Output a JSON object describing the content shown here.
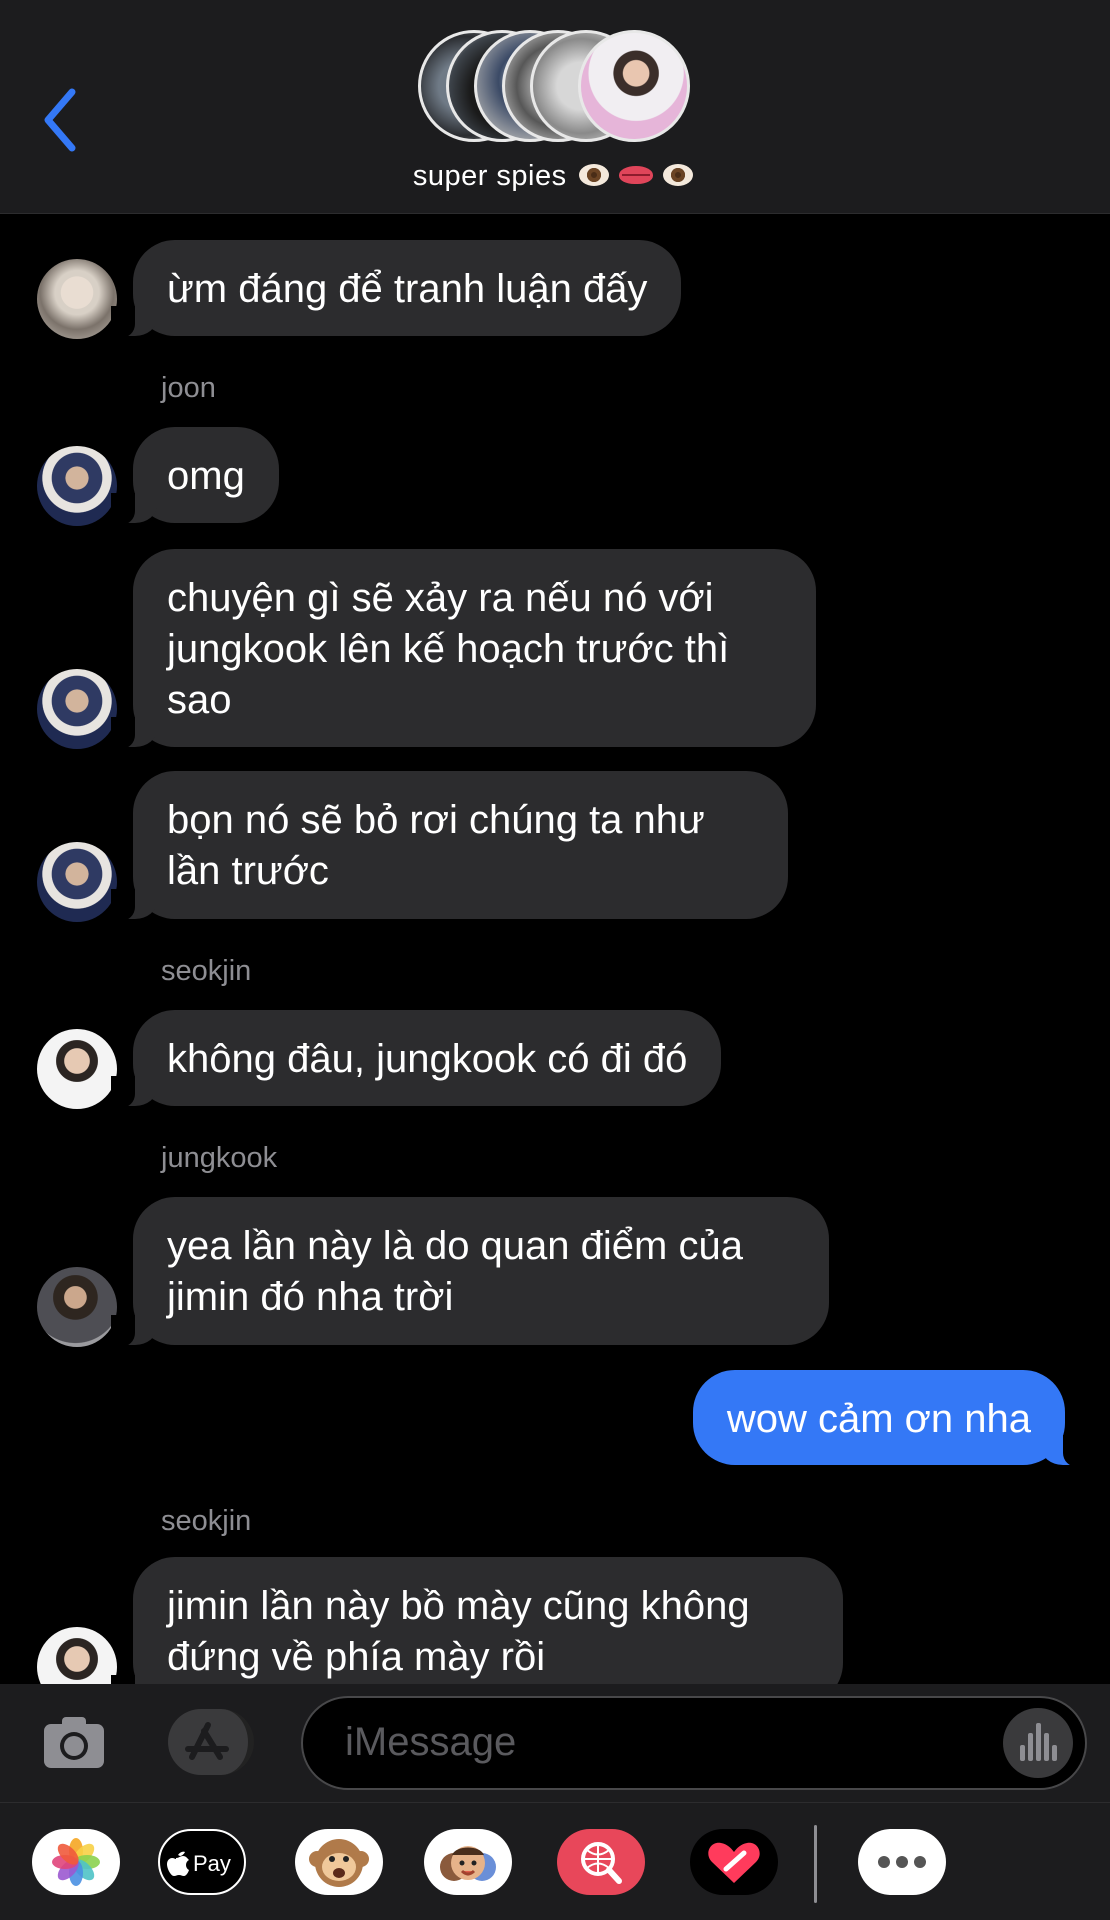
{
  "header": {
    "group_name": "super spies",
    "back_label": "Back"
  },
  "messages": [
    {
      "sender": "",
      "text": "ừm đáng để tranh luận đấy",
      "avatar": "yoongi"
    },
    {
      "sender": "joon",
      "text": "omg",
      "avatar": "joon"
    },
    {
      "sender": "",
      "text": "chuyện gì sẽ xảy ra nếu nó với jungkook lên kế hoạch trước thì sao",
      "avatar": "joon"
    },
    {
      "sender": "",
      "text": "bọn nó sẽ bỏ rơi chúng ta như lần trước",
      "avatar": "joon"
    },
    {
      "sender": "seokjin",
      "text": "không đâu, jungkook có đi đó",
      "avatar": "seokjin"
    },
    {
      "sender": "jungkook",
      "text": "yea lần này là do quan điểm của jimin đó nha trời",
      "avatar": "jungkook"
    },
    {
      "sender": "me",
      "text": "wow cảm ơn nha"
    },
    {
      "sender": "seokjin",
      "text": "jimin lần này bồ mày cũng không đứng về phía mày rồi",
      "avatar": "seokjin"
    }
  ],
  "compose": {
    "placeholder": "iMessage"
  },
  "drawer": {
    "apps": [
      "photos-icon",
      "apple-pay-icon",
      "animoji-icon",
      "memoji-icon",
      "search-images-icon",
      "digital-touch-icon",
      "more-icon"
    ],
    "pay_label": "Pay"
  },
  "colors": {
    "incoming_bubble": "#2c2c2e",
    "outgoing_bubble": "#3478f6",
    "accent": "#3478f6"
  }
}
